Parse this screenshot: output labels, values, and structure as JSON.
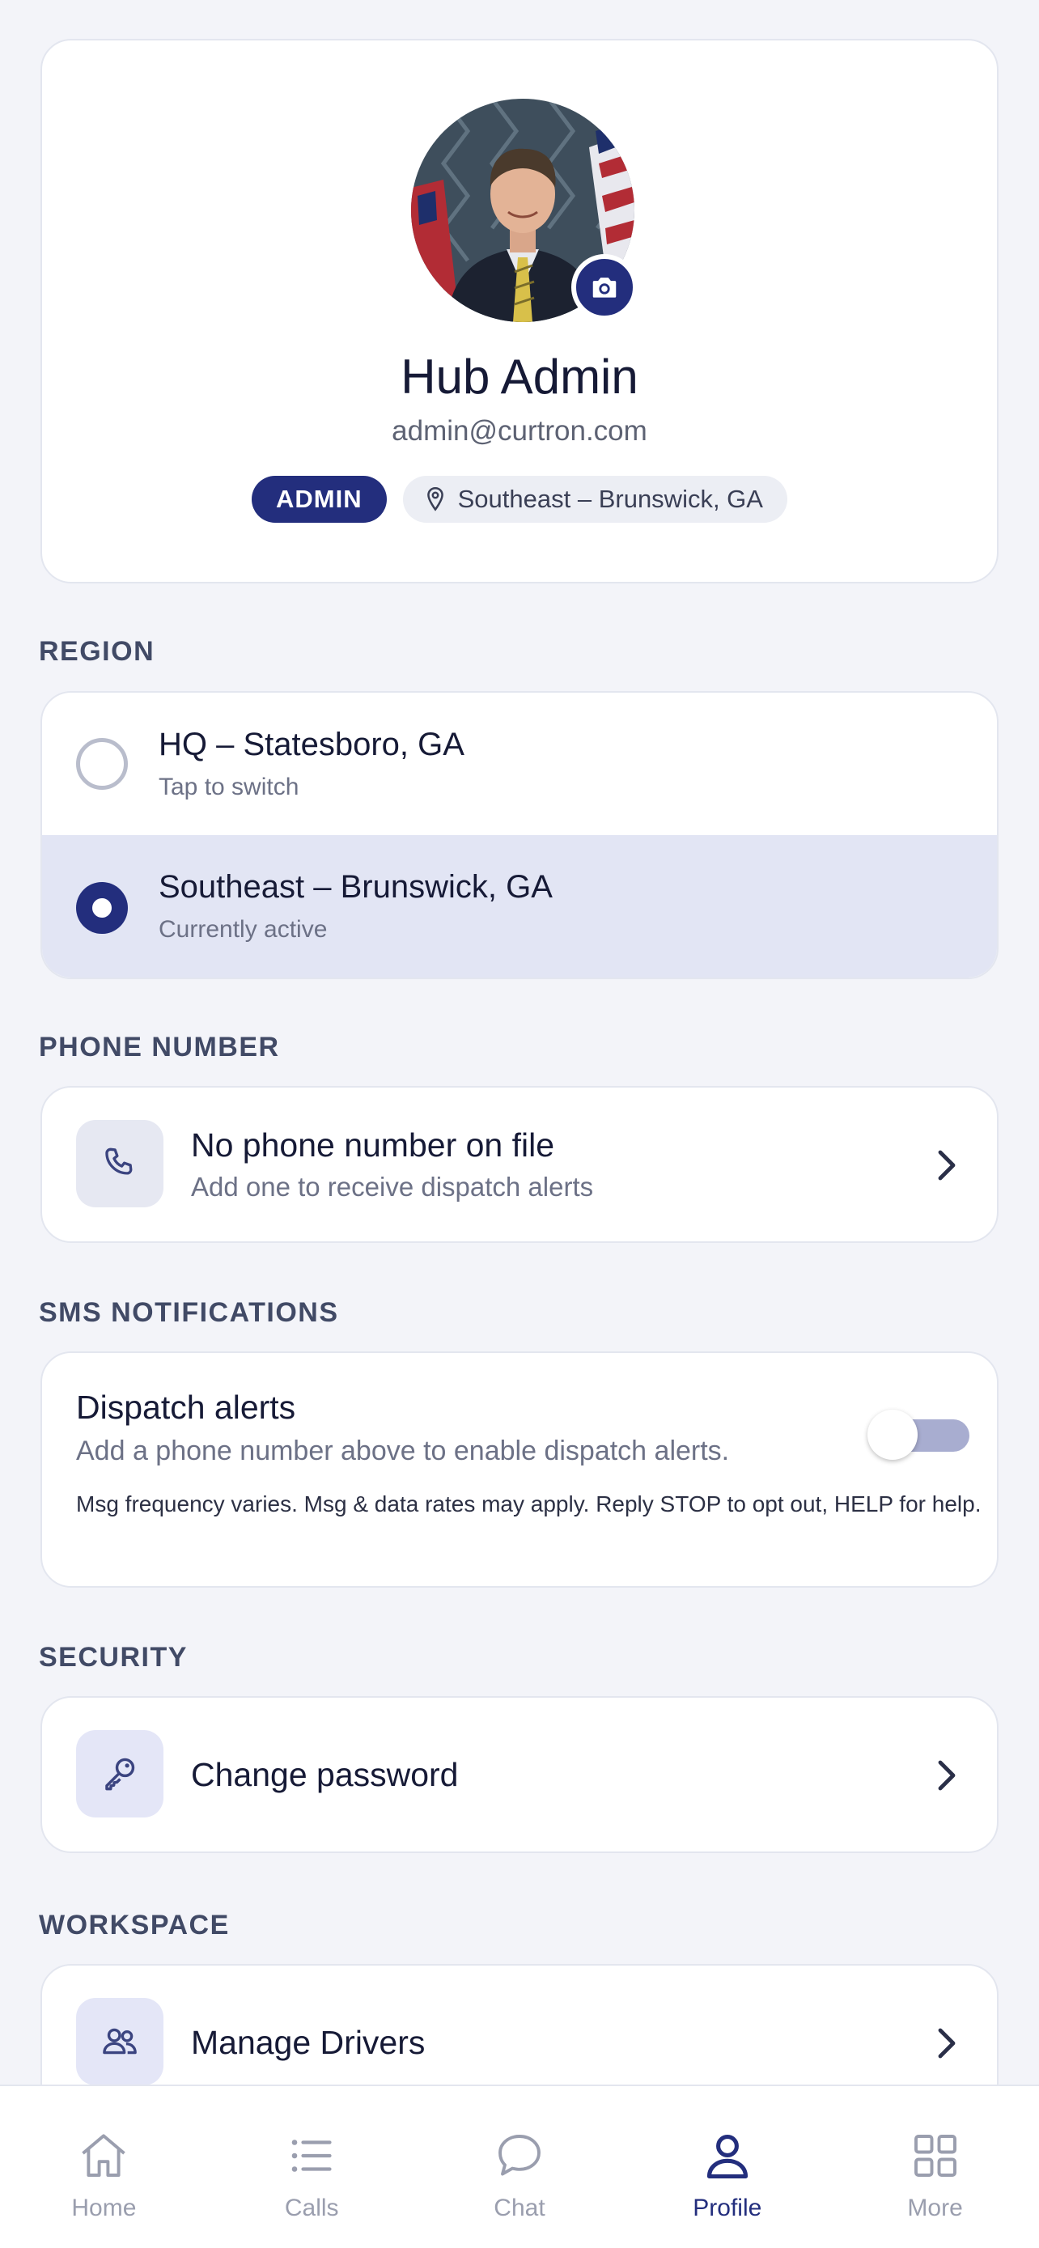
{
  "profile": {
    "name": "Hub Admin",
    "email": "admin@curtron.com",
    "role_badge": "ADMIN",
    "location_badge": "Southeast – Brunswick, GA"
  },
  "region": {
    "section_title": "REGION",
    "options": [
      {
        "label": "HQ – Statesboro, GA",
        "sub": "Tap to switch",
        "selected": false
      },
      {
        "label": "Southeast – Brunswick, GA",
        "sub": "Currently active",
        "selected": true
      }
    ]
  },
  "phone": {
    "section_title": "PHONE NUMBER",
    "title": "No phone number on file",
    "sub": "Add one to receive dispatch alerts"
  },
  "sms": {
    "section_title": "SMS NOTIFICATIONS",
    "title": "Dispatch alerts",
    "sub": "Add a phone number above to enable dispatch alerts.",
    "fine_print": "Msg frequency varies. Msg & data rates may apply. Reply STOP to opt out, HELP for help.",
    "toggle_on": false
  },
  "security": {
    "section_title": "SECURITY",
    "change_password": "Change password"
  },
  "workspace": {
    "section_title": "WORKSPACE",
    "manage_drivers": "Manage Drivers"
  },
  "tabs": [
    {
      "label": "Home",
      "icon": "home-icon",
      "active": false
    },
    {
      "label": "Calls",
      "icon": "list-icon",
      "active": false
    },
    {
      "label": "Chat",
      "icon": "chat-icon",
      "active": false
    },
    {
      "label": "Profile",
      "icon": "user-icon",
      "active": true
    },
    {
      "label": "More",
      "icon": "grid-icon",
      "active": false
    }
  ],
  "colors": {
    "accent": "#232e7d",
    "background": "#f3f4f9",
    "active_row": "#e2e5f4"
  }
}
